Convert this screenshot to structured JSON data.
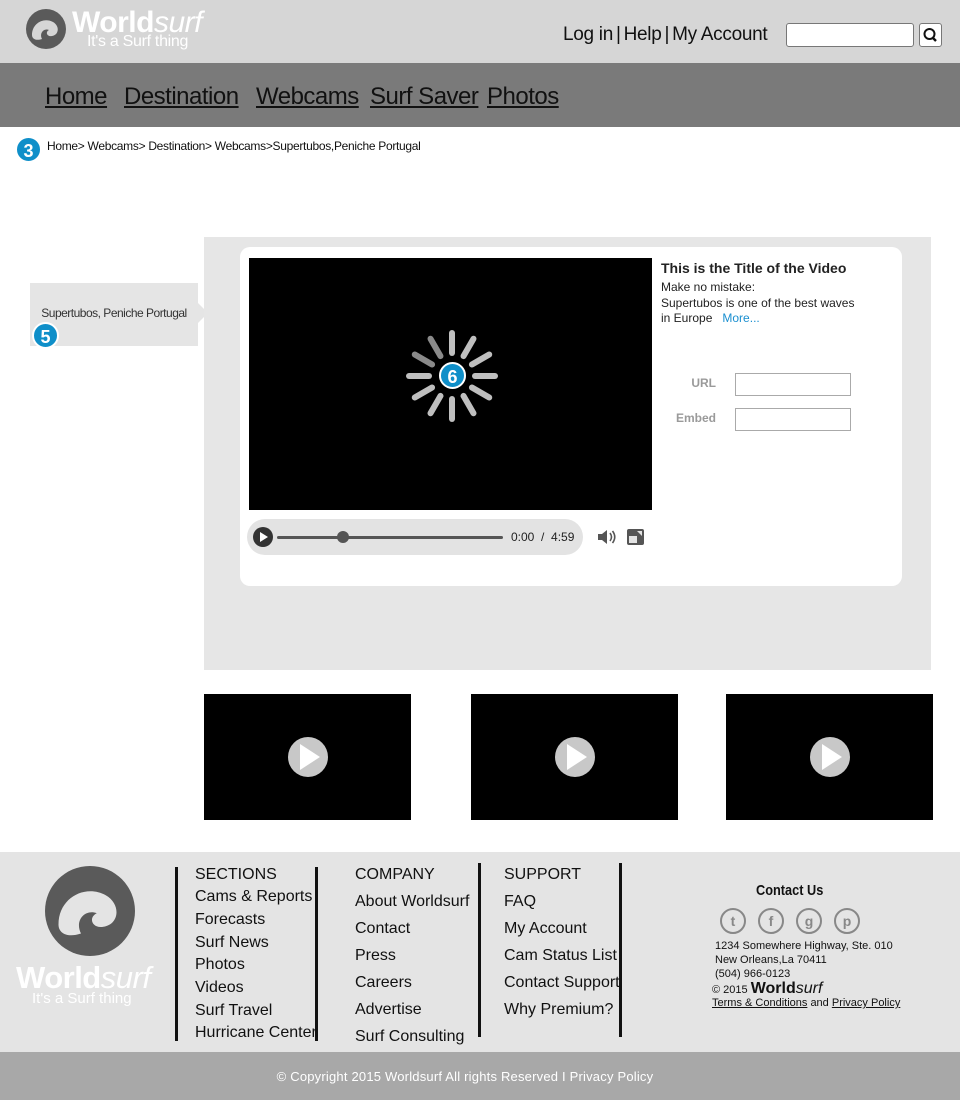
{
  "brand": {
    "name_bold": "World",
    "name_light": "surf",
    "tagline": "It's a Surf thing"
  },
  "header": {
    "links": [
      "Log in",
      "Help",
      "My Account"
    ],
    "separator": "|",
    "search_value": ""
  },
  "nav": {
    "items": [
      "Home",
      "Destination",
      "Webcams",
      "Surf Saver",
      "Photos"
    ]
  },
  "breadcrumb": {
    "badge": "3",
    "text": "Home> Webcams> Destination> Webcams>Supertubos,Peniche Portugal"
  },
  "location_tag": {
    "label": "Supertubos, Peniche Portugal",
    "badge": "5"
  },
  "player": {
    "loading_badge": "6",
    "time_current": "0:00",
    "time_separator": "/",
    "time_total": "4:59",
    "progress_fraction": 0.29
  },
  "video_info": {
    "title": "This is the Title of the Video",
    "desc_line1": "Make no mistake:",
    "desc_line2": "Supertubos is one of the best waves",
    "desc_line3": "in Europe",
    "more_link": "More...",
    "url_label": "URL",
    "url_value": "",
    "embed_label": "Embed",
    "embed_value": ""
  },
  "thumbnails": [
    "play-icon",
    "play-icon",
    "play-icon"
  ],
  "footer": {
    "sections": {
      "title": "SECTIONS",
      "items": [
        "Cams & Reports",
        "Forecasts",
        "Surf News",
        "Photos",
        "Videos",
        "Surf Travel",
        "Hurricane Center"
      ]
    },
    "company": {
      "title": "COMPANY",
      "items": [
        "About Worldsurf",
        "Contact",
        "Press",
        "Careers",
        "Advertise",
        "Surf Consulting"
      ]
    },
    "support": {
      "title": "SUPPORT",
      "items": [
        "FAQ",
        "My Account",
        "Cam Status List",
        "Contact Support",
        "Why Premium?"
      ]
    },
    "contact": {
      "title": "Contact Us",
      "social": [
        "twitter-icon",
        "facebook-icon",
        "google-plus-icon",
        "pinterest-icon"
      ],
      "address1": "1234 Somewhere Highway, Ste. 010",
      "address2": "New Orleans,La 70411",
      "phone": "(504) 966-0123",
      "copyright_prefix": "© 2015",
      "terms": "Terms & Conditions",
      "and": "and",
      "privacy": "Privacy Policy"
    },
    "copyright": "© Copyright 2015 Worldsurf All rights Reserved I Privacy Policy"
  },
  "colors": {
    "accent": "#0f8fc9",
    "link": "#1a8fd0",
    "header_bg": "#d6d6d6",
    "nav_bg": "#7a7a7a"
  }
}
